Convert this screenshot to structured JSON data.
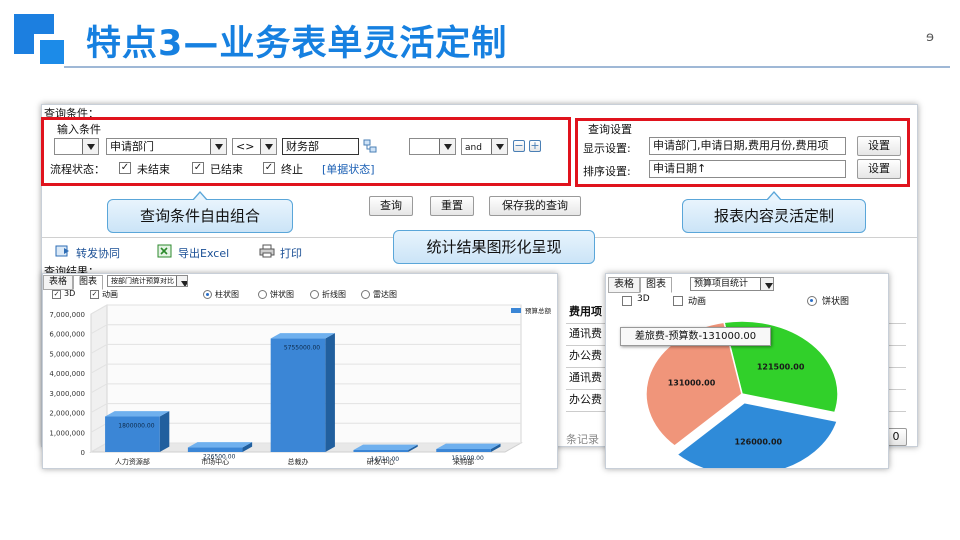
{
  "slide": {
    "title": "特点3—业务表单灵活定制",
    "corner_mark": "ɘ"
  },
  "query": {
    "section_label": "查询条件：",
    "input_group_label": "输入条件",
    "field_select": "申请部门",
    "operator_select": "<>",
    "value_input": "财务部",
    "logic_select": "and",
    "flow_status_label": "流程状态：",
    "status_options": [
      {
        "label": "未结束",
        "checked": true
      },
      {
        "label": "已结束",
        "checked": true
      },
      {
        "label": "终止",
        "checked": true
      }
    ],
    "doc_status_link": "[单据状态]",
    "buttons": [
      "查询",
      "重置",
      "保存我的查询"
    ]
  },
  "settings": {
    "group_label": "查询设置",
    "display_label": "显示设置:",
    "display_value": "申请部门,申请日期,费用月份,费用项",
    "sort_label": "排序设置:",
    "sort_value": "申请日期↑",
    "set_button": "设置"
  },
  "callouts": {
    "left": "查询条件自由组合",
    "right": "报表内容灵活定制",
    "middle": "统计结果图形化呈现"
  },
  "toolbar": {
    "forward": "转发协同",
    "export": "导出Excel",
    "print": "打印"
  },
  "result": {
    "label": "查询结果：",
    "tabs": [
      "表格",
      "图表"
    ],
    "rows": [
      "费用项",
      "通讯费",
      "办公费",
      "通讯费",
      "办公费"
    ],
    "footer_text": "条记录",
    "footer_button": "0"
  },
  "bar_panel": {
    "dropdown": "按部门统计预算对比",
    "options": [
      {
        "label": "3D",
        "checked": true
      },
      {
        "label": "动画",
        "checked": true
      }
    ],
    "radios": [
      {
        "label": "柱状图",
        "selected": true
      },
      {
        "label": "饼状图",
        "selected": false
      },
      {
        "label": "折线图",
        "selected": false
      },
      {
        "label": "雷达图",
        "selected": false
      }
    ]
  },
  "pie_panel": {
    "dropdown": "预算项目统计",
    "options": [
      {
        "label": "3D",
        "checked": false
      },
      {
        "label": "动画",
        "checked": false
      }
    ],
    "radio": "饼状图",
    "tooltip": "差旅费-预算数-131000.00"
  },
  "chart_data": [
    {
      "type": "bar",
      "categories": [
        "人力资源部",
        "市场中心",
        "总裁办",
        "研发中心",
        "采购部"
      ],
      "series": [
        {
          "name": "预算总额",
          "values": [
            1800000.0,
            226500.0,
            5755000.0,
            14710.0,
            151500.0
          ],
          "labels": [
            "1800000.00",
            "226500.00",
            "5755000.00",
            "14710.00",
            "151500.00"
          ]
        }
      ],
      "ylim": [
        0,
        7000000
      ],
      "yticks": [
        "0",
        "1,000,000",
        "2,000,000",
        "3,000,000",
        "4,000,000",
        "5,000,000",
        "6,000,000",
        "7,000,000"
      ],
      "grid": true,
      "legend": "top-right",
      "color": "#3b86d6"
    },
    {
      "type": "pie",
      "slices": [
        {
          "value": 121500.0,
          "label": "121500.00",
          "color": "#31d02a"
        },
        {
          "value": 126000.0,
          "label": "126000.00",
          "color": "#2f8bd9"
        },
        {
          "value": 131000.0,
          "label": "131000.00",
          "color": "#f0957a"
        }
      ]
    }
  ]
}
